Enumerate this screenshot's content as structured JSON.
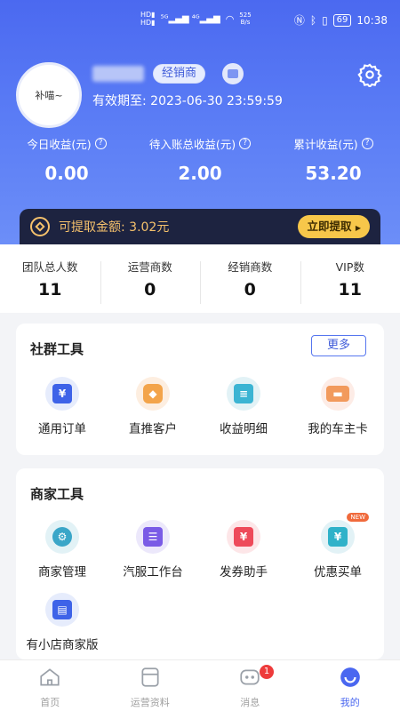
{
  "status_bar": {
    "network_left": "HD",
    "network_speed": "525\nB/s",
    "battery": "69",
    "time": "10:38"
  },
  "profile": {
    "avatar_text": "补喵~",
    "role_badge": "经销商",
    "validity_label": "有效期至:",
    "validity_date": "2023-06-30 23:59:59"
  },
  "earnings": [
    {
      "label": "今日收益(元)",
      "value": "0.00"
    },
    {
      "label": "待入账总收益(元)",
      "value": "2.00"
    },
    {
      "label": "累计收益(元)",
      "value": "53.20"
    }
  ],
  "withdraw": {
    "text": "可提取金额: 3.02元",
    "button": "立即提取",
    "accent": "#f5c16c"
  },
  "team": [
    {
      "label": "团队总人数",
      "value": "11"
    },
    {
      "label": "运营商数",
      "value": "0"
    },
    {
      "label": "经销商数",
      "value": "0"
    },
    {
      "label": "VIP数",
      "value": "11"
    }
  ],
  "social_tools": {
    "title": "社群工具",
    "more": "更多",
    "items": [
      {
        "label": "通用订单",
        "icon": "order-icon"
      },
      {
        "label": "直推客户",
        "icon": "customer-icon"
      },
      {
        "label": "收益明细",
        "icon": "receipt-icon"
      },
      {
        "label": "我的车主卡",
        "icon": "card-icon"
      }
    ]
  },
  "merchant_tools": {
    "title": "商家工具",
    "items": [
      {
        "label": "商家管理",
        "icon": "settings-icon"
      },
      {
        "label": "汽服工作台",
        "icon": "workbench-icon"
      },
      {
        "label": "发券助手",
        "icon": "coupon-icon"
      },
      {
        "label": "优惠买单",
        "icon": "discount-bill-icon",
        "badge": "NEW"
      },
      {
        "label": "有小店商家版",
        "icon": "store-icon"
      }
    ]
  },
  "tabbar": [
    {
      "label": "首页"
    },
    {
      "label": "运营资料"
    },
    {
      "label": "消息",
      "badge": "1"
    },
    {
      "label": "我的"
    }
  ],
  "colors": {
    "primary": "#4a67f0",
    "header_gradient_top": "#4b69f0",
    "withdraw_bar": "#1d2340",
    "badge_red": "#ee3b3b"
  }
}
